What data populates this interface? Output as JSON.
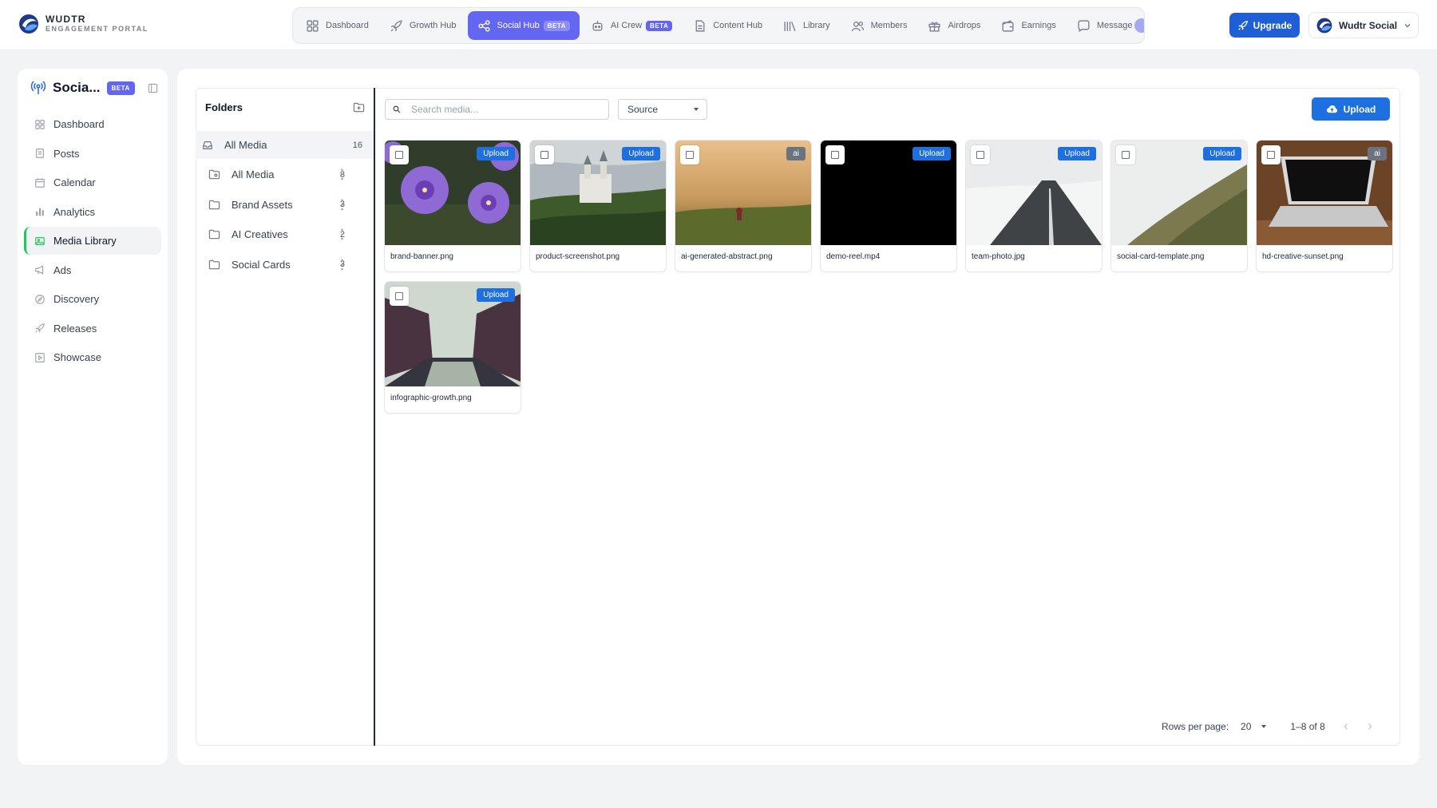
{
  "brand": {
    "name": "WUDTR",
    "subtitle": "ENGAGEMENT PORTAL"
  },
  "nav": [
    {
      "label": "Dashboard",
      "icon": "grid-icon"
    },
    {
      "label": "Growth Hub",
      "icon": "rocket-icon"
    },
    {
      "label": "Social Hub",
      "icon": "share-icon",
      "badge": "BETA",
      "active": true
    },
    {
      "label": "AI Crew",
      "icon": "robot-icon",
      "badge": "BETA"
    },
    {
      "label": "Content Hub",
      "icon": "document-icon"
    },
    {
      "label": "Library",
      "icon": "books-icon"
    },
    {
      "label": "Members",
      "icon": "users-icon"
    },
    {
      "label": "Airdrops",
      "icon": "gift-icon"
    },
    {
      "label": "Earnings",
      "icon": "wallet-icon"
    },
    {
      "label": "Message",
      "icon": "chat-icon"
    }
  ],
  "header": {
    "upgrade_label": "Upgrade",
    "account_name": "Wudtr Social"
  },
  "sidebar": {
    "title": "Socia...",
    "badge": "BETA",
    "items": [
      {
        "label": "Dashboard",
        "icon": "grid-icon"
      },
      {
        "label": "Posts",
        "icon": "document-icon"
      },
      {
        "label": "Calendar",
        "icon": "calendar-icon"
      },
      {
        "label": "Analytics",
        "icon": "bar-chart-icon"
      },
      {
        "label": "Media Library",
        "icon": "image-icon",
        "active": true
      },
      {
        "label": "Ads",
        "icon": "megaphone-icon"
      },
      {
        "label": "Discovery",
        "icon": "compass-icon"
      },
      {
        "label": "Releases",
        "icon": "rocket-icon"
      },
      {
        "label": "Showcase",
        "icon": "play-square-icon"
      }
    ]
  },
  "folders": {
    "title": "Folders",
    "root": {
      "label": "All Media",
      "count": "16"
    },
    "items": [
      {
        "label": "All Media",
        "count": "8"
      },
      {
        "label": "Brand Assets",
        "count": "3"
      },
      {
        "label": "AI Creatives",
        "count": "2"
      },
      {
        "label": "Social Cards",
        "count": "3"
      }
    ]
  },
  "toolbar": {
    "search_placeholder": "Search media...",
    "source_label": "Source",
    "upload_label": "Upload"
  },
  "media": [
    {
      "name": "brand-banner.png",
      "tag": "Upload",
      "thumb": "flowers"
    },
    {
      "name": "product-screenshot.png",
      "tag": "Upload",
      "thumb": "castle"
    },
    {
      "name": "ai-generated-abstract.png",
      "tag": "ai",
      "thumb": "field"
    },
    {
      "name": "demo-reel.mp4",
      "tag": "Upload",
      "thumb": "black"
    },
    {
      "name": "team-photo.jpg",
      "tag": "Upload",
      "thumb": "road"
    },
    {
      "name": "social-card-template.png",
      "tag": "Upload",
      "thumb": "forest"
    },
    {
      "name": "hd-creative-sunset.png",
      "tag": "ai",
      "thumb": "laptop"
    },
    {
      "name": "infographic-growth.png",
      "tag": "Upload",
      "thumb": "canal"
    }
  ],
  "pagination": {
    "rows_label": "Rows per page:",
    "rows_value": "20",
    "range": "1–8 of 8"
  },
  "colors": {
    "accent": "#6366f1",
    "primary": "#1e6fe0",
    "active_marker": "#22c55e"
  }
}
